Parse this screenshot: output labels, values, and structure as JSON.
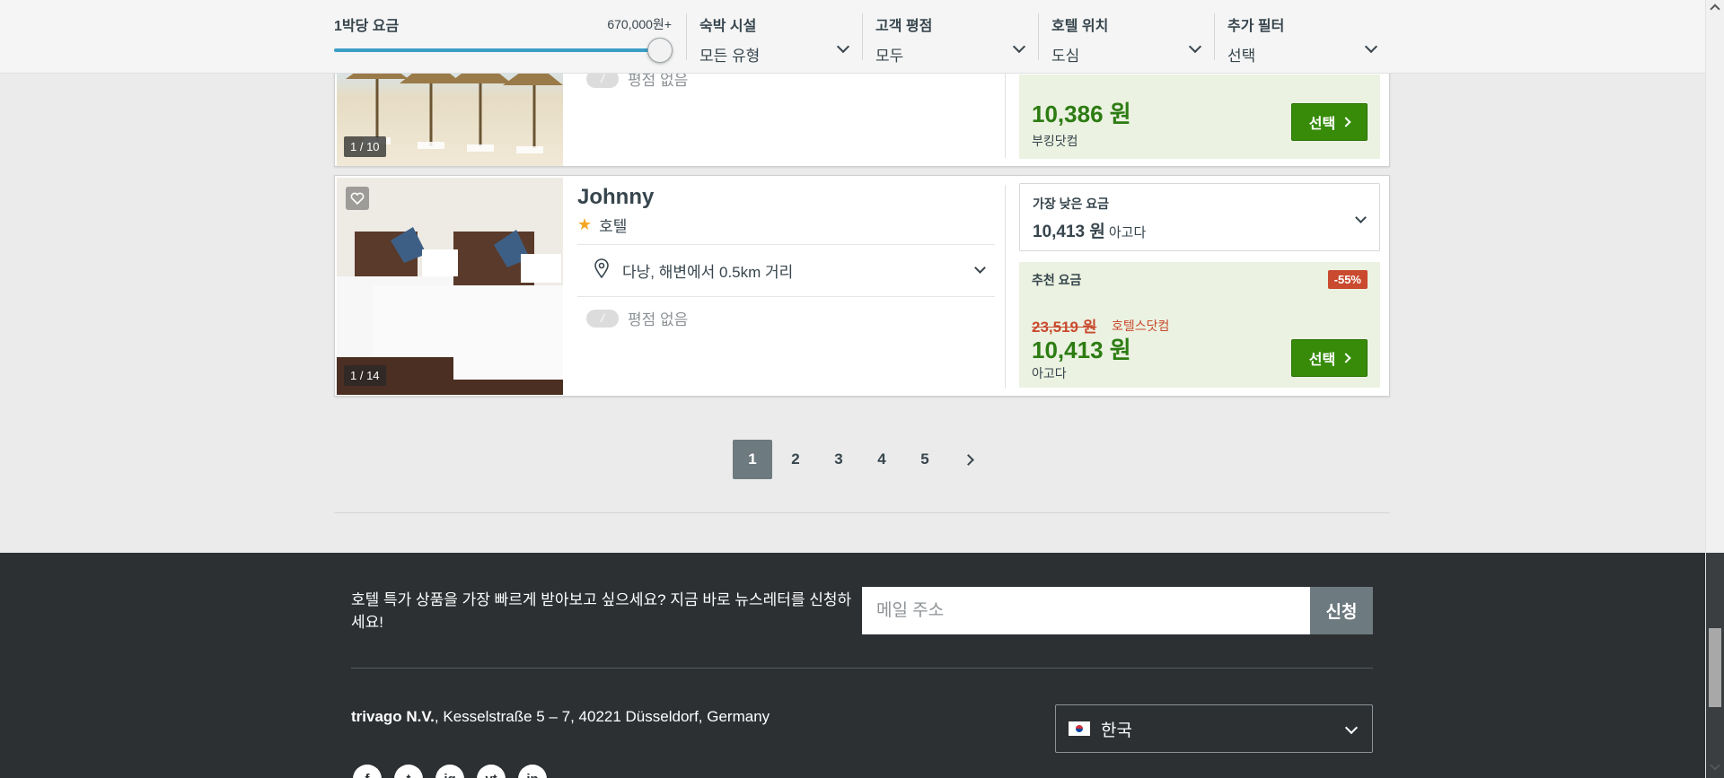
{
  "filters": {
    "price": {
      "label": "1박당 요금",
      "max": "670,000원+",
      "slider_level": 1.0
    },
    "property_type": {
      "label": "숙박 시설",
      "value": "모든 유형"
    },
    "guest_rating": {
      "label": "고객 평점",
      "value": "모두"
    },
    "location": {
      "label": "호텔 위치",
      "value": "도심"
    },
    "more": {
      "label": "추가 필터",
      "value": "선택"
    }
  },
  "results": [
    {
      "image_counter": "1 / 10",
      "rating_badge": "/",
      "rating_text": "평점 없음",
      "deal_price": "10,386 원",
      "deal_site": "부킹닷컴",
      "select_label": "선택"
    },
    {
      "name": "Johnny",
      "type": "호텔",
      "stars": 1,
      "image_counter": "1 / 14",
      "location": "다낭, 해변에서 0.5km 거리",
      "rating_badge": "/",
      "rating_text": "평점 없음",
      "lowest_title": "가장 낮은 요금",
      "lowest_price": "10,413 원",
      "lowest_site": "아고다",
      "deal_title": "추천 요금",
      "discount": "-55%",
      "old_price": "23,519 원",
      "old_site": "호텔스닷컴",
      "deal_price": "10,413 원",
      "deal_site": "아고다",
      "select_label": "선택"
    }
  ],
  "pagination": {
    "pages": [
      "1",
      "2",
      "3",
      "4",
      "5"
    ],
    "current": "1"
  },
  "footer": {
    "newsletter_text": "호텔 특가 상품을 가장 빠르게 받아보고 싶으세요? 지금 바로 뉴스레터를 신청하세요!",
    "email_placeholder": "메일 주소",
    "subscribe_label": "신청",
    "company": "trivago N.V.",
    "address": ", Kesselstraße 5 – 7, 40221 Düsseldorf, Germany",
    "language": "한국",
    "socials": [
      "f",
      "t",
      "ig",
      "yt",
      "in"
    ]
  },
  "colors": {
    "accent_blue": "#3a9ec6",
    "deal_green": "#2d7c13",
    "select_button": "#378b09",
    "discount_red": "#c94a2f",
    "footer_bg": "#2c3033"
  }
}
